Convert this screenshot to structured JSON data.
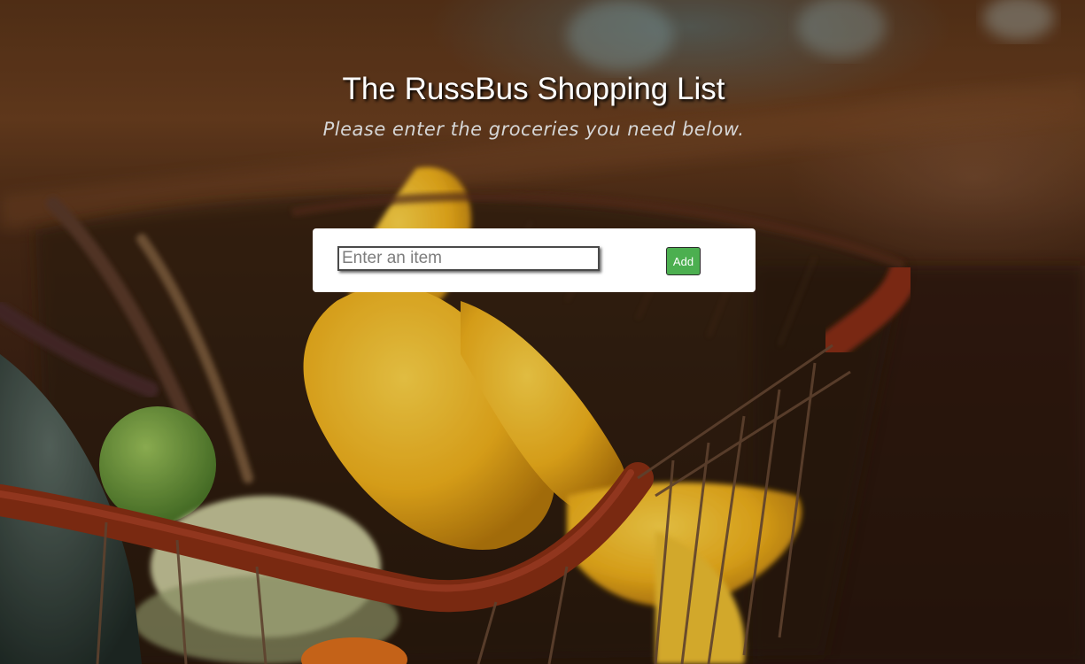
{
  "header": {
    "title": "The RussBus Shopping List",
    "subtitle": "Please enter the groceries you need below."
  },
  "form": {
    "input_placeholder": "Enter an item",
    "input_value": "",
    "add_label": "Add",
    "add_button_color": "#4caf50"
  },
  "background": {
    "description_icon": "vegetable-basket-photo"
  }
}
